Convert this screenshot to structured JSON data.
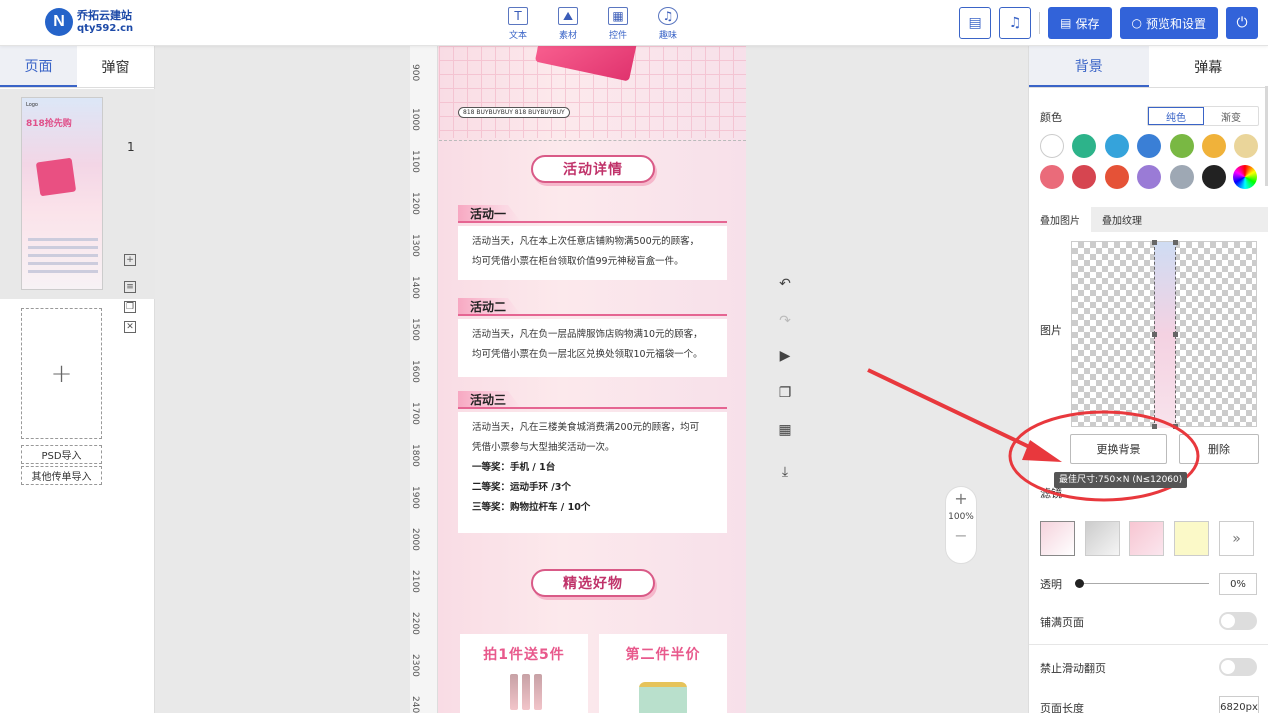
{
  "brand": {
    "logo_letter": "N",
    "name": "乔拓云建站",
    "domain": "qty592.cn"
  },
  "toolbar": {
    "tools": [
      {
        "label": "文本",
        "glyph": "T"
      },
      {
        "label": "素材",
        "glyph": "⛰"
      },
      {
        "label": "控件",
        "glyph": "▦"
      },
      {
        "label": "趣味",
        "glyph": "♫"
      }
    ],
    "save_label": "保存",
    "preview_label": "预览和设置"
  },
  "left_panel": {
    "tabs": [
      "页面",
      "弹窗"
    ],
    "page_number": "1",
    "thumb_title": "818抢先购",
    "thumb_logo": "Logo",
    "psd_import": "PSD导入",
    "other_import": "其他传单导入"
  },
  "ruler": [
    "900",
    "1000",
    "1100",
    "1200",
    "1300",
    "1400",
    "1500",
    "1600",
    "1700",
    "1800",
    "1900",
    "2000",
    "2100",
    "2200",
    "2300",
    "2400"
  ],
  "canvas": {
    "buy_tag": "818 BUYBUYBUY 818 BUYBUYBUY",
    "section1": "活动详情",
    "activities": [
      {
        "title": "活动一",
        "lines": [
          "活动当天，凡在本上次任意店铺购物满500元的顾客，",
          "均可凭借小票在柜台领取价值99元神秘盲盒一件。"
        ]
      },
      {
        "title": "活动二",
        "lines": [
          "活动当天，凡在负一层品牌服饰店购物满10元的顾客，",
          "均可凭借小票在负一层北区兑换处领取10元福袋一个。"
        ]
      },
      {
        "title": "活动三",
        "lines": [
          "活动当天，凡在三楼美食城消费满200元的顾客，均可",
          "凭借小票参与大型抽奖活动一次。"
        ],
        "prizes": [
          "一等奖：手机 / 1台",
          "二等奖：运动手环 /3个",
          "三等奖：购物拉杆车 / 10个"
        ]
      }
    ],
    "section2": "精选好物",
    "products": [
      "拍1件送5件",
      "第二件半价"
    ]
  },
  "zoom": {
    "plus": "+",
    "value": "100%",
    "minus": "−"
  },
  "right_panel": {
    "tabs": [
      "背景",
      "弹幕"
    ],
    "color_label": "颜色",
    "color_modes": [
      "纯色",
      "渐变"
    ],
    "swatches_row1": [
      "#ffffff",
      "#2db38a",
      "#35a3db",
      "#3a7fd6",
      "#79b843",
      "#f0b23a",
      "#ead59a"
    ],
    "swatches_row2": [
      "#ea6b7a",
      "#d64550",
      "#e55237",
      "#9a7bd6",
      "#9ea8b4",
      "#222222"
    ],
    "overlay_tabs": [
      "叠加图片",
      "叠加纹理"
    ],
    "image_label": "图片",
    "replace_bg": "更换背景",
    "delete": "删除",
    "tooltip": "最佳尺寸:750×N (N≤12060)",
    "filter_label": "滤镜",
    "more": "»",
    "opacity_label": "透明",
    "opacity_value": "0%",
    "fill_page_label": "铺满页面",
    "disable_scroll_label": "禁止滑动翻页",
    "page_length_label": "页面长度",
    "page_length_value": "6820px"
  },
  "annotation_color": "#e8383d"
}
